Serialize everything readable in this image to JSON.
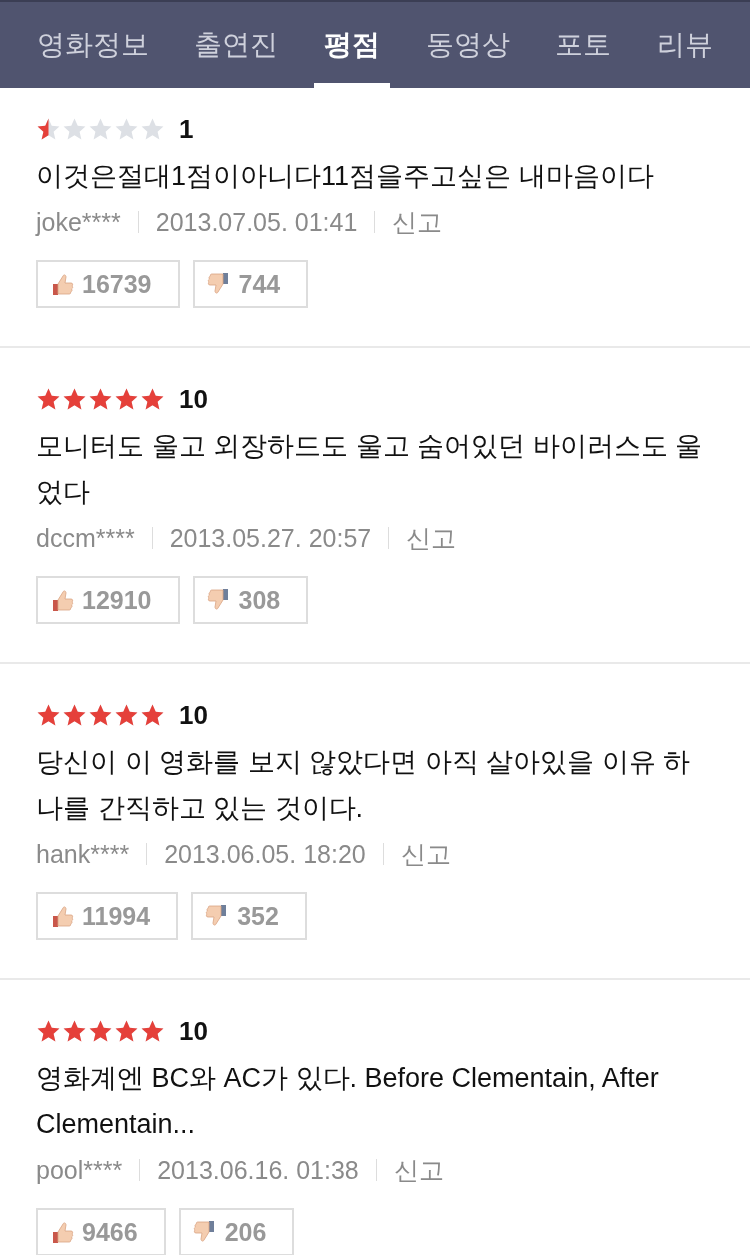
{
  "tabs": [
    {
      "label": "영화정보",
      "selected": false
    },
    {
      "label": "출연진",
      "selected": false
    },
    {
      "label": "평점",
      "selected": true
    },
    {
      "label": "동영상",
      "selected": false
    },
    {
      "label": "포토",
      "selected": false
    },
    {
      "label": "리뷰",
      "selected": false
    }
  ],
  "reviews": [
    {
      "stars": 0.5,
      "score": "1",
      "text": "이것은절대1점이아니다11점을주고싶은 내마음이다",
      "author": "joke****",
      "date": "2013.07.05. 01:41",
      "report": "신고",
      "likes": "16739",
      "dislikes": "744"
    },
    {
      "stars": 5,
      "score": "10",
      "text": "모니터도 울고 외장하드도 울고 숨어있던 바이러스도 울었다",
      "author": "dccm****",
      "date": "2013.05.27. 20:57",
      "report": "신고",
      "likes": "12910",
      "dislikes": "308"
    },
    {
      "stars": 5,
      "score": "10",
      "text": "당신이 이 영화를 보지 않았다면 아직 살아있을 이유 하나를 간직하고 있는 것이다.",
      "author": "hank****",
      "date": "2013.06.05. 18:20",
      "report": "신고",
      "likes": "11994",
      "dislikes": "352"
    },
    {
      "stars": 5,
      "score": "10",
      "text": "영화계엔 BC와 AC가 있다. Before Clementain, After Clementain...",
      "author": "pool****",
      "date": "2013.06.16. 01:38",
      "report": "신고",
      "likes": "9466",
      "dislikes": "206"
    }
  ]
}
